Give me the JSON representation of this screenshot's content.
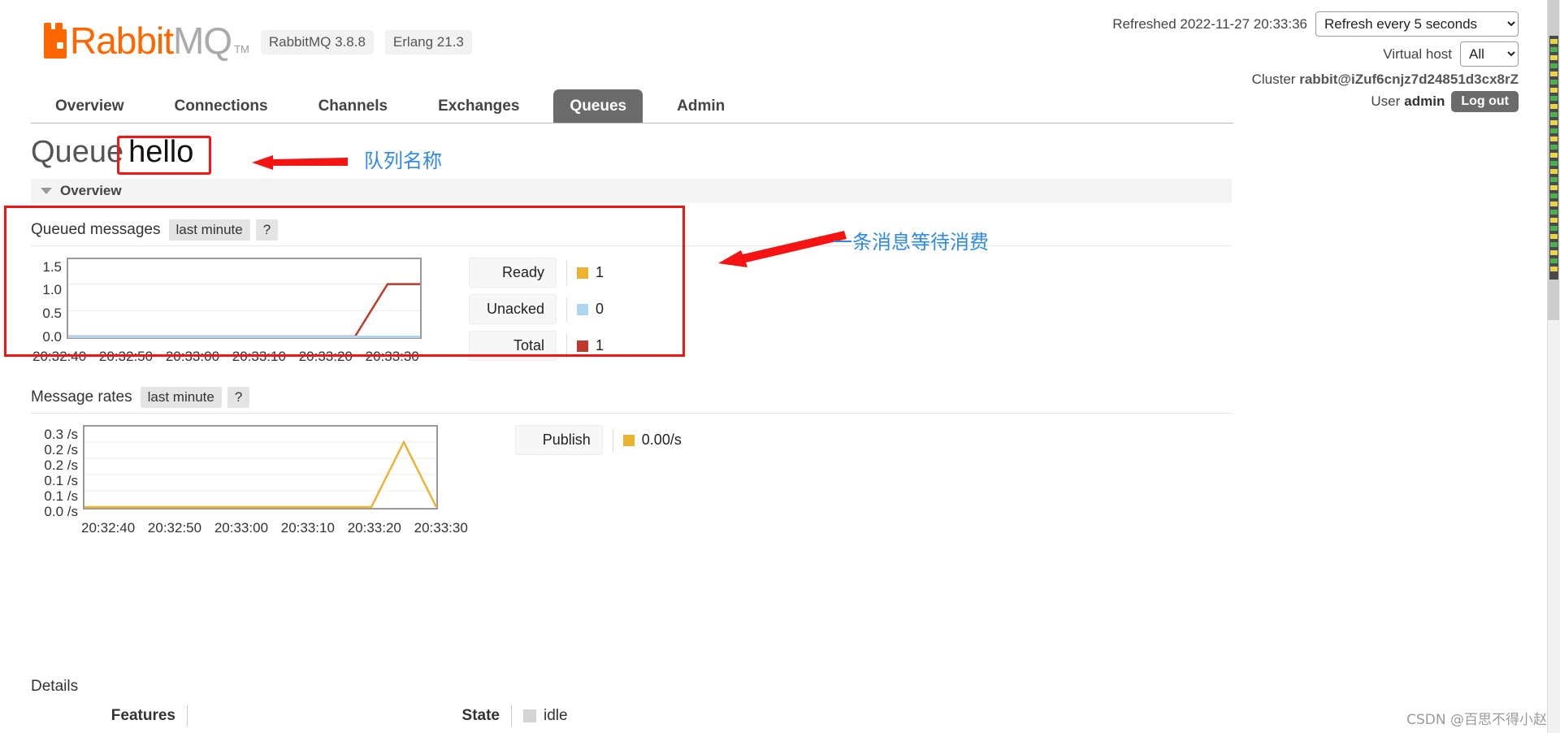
{
  "header": {
    "logo_text_a": "Rabbit",
    "logo_text_b": "MQ",
    "logo_tm": "TM",
    "version_badge": "RabbitMQ 3.8.8",
    "erlang_badge": "Erlang 21.3",
    "refreshed_label": "Refreshed 2022-11-27 20:33:36",
    "refresh_select": "Refresh every 5 seconds",
    "refresh_options": [
      "Refresh every 5 seconds"
    ],
    "vhost_label": "Virtual host",
    "vhost_select": "All",
    "vhost_options": [
      "All"
    ],
    "cluster_label": "Cluster",
    "cluster_name": "rabbit@iZuf6cnjz7d24851d3cx8rZ",
    "user_label": "User",
    "user_name": "admin",
    "logout_label": "Log out"
  },
  "nav": {
    "tabs": [
      {
        "label": "Overview",
        "active": false
      },
      {
        "label": "Connections",
        "active": false
      },
      {
        "label": "Channels",
        "active": false
      },
      {
        "label": "Exchanges",
        "active": false
      },
      {
        "label": "Queues",
        "active": true
      },
      {
        "label": "Admin",
        "active": false
      }
    ]
  },
  "page": {
    "title_prefix": "Queue",
    "queue_name": "hello",
    "overview_section_label": "Overview",
    "details_label": "Details"
  },
  "annotations": [
    {
      "text": "队列名称",
      "color": "#2e8ae6"
    },
    {
      "text": "一条消息等待消费",
      "color": "#2e8ae6"
    }
  ],
  "queued_messages": {
    "title": "Queued messages",
    "range_pill": "last minute",
    "help": "?",
    "legend": [
      {
        "label": "Ready",
        "value": "1",
        "color": "#edb330"
      },
      {
        "label": "Unacked",
        "value": "0",
        "color": "#aed6f1"
      },
      {
        "label": "Total",
        "value": "1",
        "color": "#c0392b"
      }
    ]
  },
  "message_rates": {
    "title": "Message rates",
    "range_pill": "last minute",
    "help": "?",
    "legend": [
      {
        "label": "Publish",
        "value": "0.00/s",
        "color": "#edb330"
      }
    ]
  },
  "details": {
    "features_label": "Features",
    "state_label": "State",
    "state_value": "idle",
    "state_swatch": "#d4d4d4"
  },
  "watermark": "CSDN @百思不得小赵",
  "chart_data": [
    {
      "type": "line",
      "title": "Queued messages",
      "xlabel": "",
      "ylabel": "",
      "ylim": [
        0.0,
        1.5
      ],
      "yticks": [
        "0.0",
        "0.5",
        "1.0",
        "1.5"
      ],
      "xticks": [
        "20:32:40",
        "20:32:50",
        "20:33:00",
        "20:33:10",
        "20:33:20",
        "20:33:30"
      ],
      "x": [
        0,
        1,
        2,
        3,
        4,
        5,
        6,
        7,
        8,
        9,
        10
      ],
      "grid": true,
      "legend_position": "right",
      "series": [
        {
          "name": "Ready",
          "color": "#edb330",
          "values": [
            0,
            0,
            0,
            0,
            0,
            0,
            0,
            0,
            0,
            0,
            0
          ]
        },
        {
          "name": "Unacked",
          "color": "#aed6f1",
          "values": [
            0,
            0,
            0,
            0,
            0,
            0,
            0,
            0,
            0,
            0,
            0
          ]
        },
        {
          "name": "Total",
          "color": "#c0392b",
          "values": [
            0,
            0,
            0,
            0,
            0,
            0,
            0,
            0,
            0,
            1,
            1
          ]
        }
      ]
    },
    {
      "type": "line",
      "title": "Message rates",
      "xlabel": "",
      "ylabel": "",
      "ylim": [
        0.0,
        0.3
      ],
      "yticks": [
        "0.0 /s",
        "0.1 /s",
        "0.1 /s",
        "0.2 /s",
        "0.2 /s",
        "0.3 /s"
      ],
      "xticks": [
        "20:32:40",
        "20:32:50",
        "20:33:00",
        "20:33:10",
        "20:33:20",
        "20:33:30"
      ],
      "x": [
        0,
        1,
        2,
        3,
        4,
        5,
        6,
        7,
        8,
        9,
        10
      ],
      "grid": true,
      "legend_position": "right",
      "series": [
        {
          "name": "Publish",
          "color": "#edb330",
          "values": [
            0,
            0,
            0,
            0,
            0,
            0,
            0,
            0,
            0.21,
            0,
            0
          ]
        }
      ]
    }
  ]
}
